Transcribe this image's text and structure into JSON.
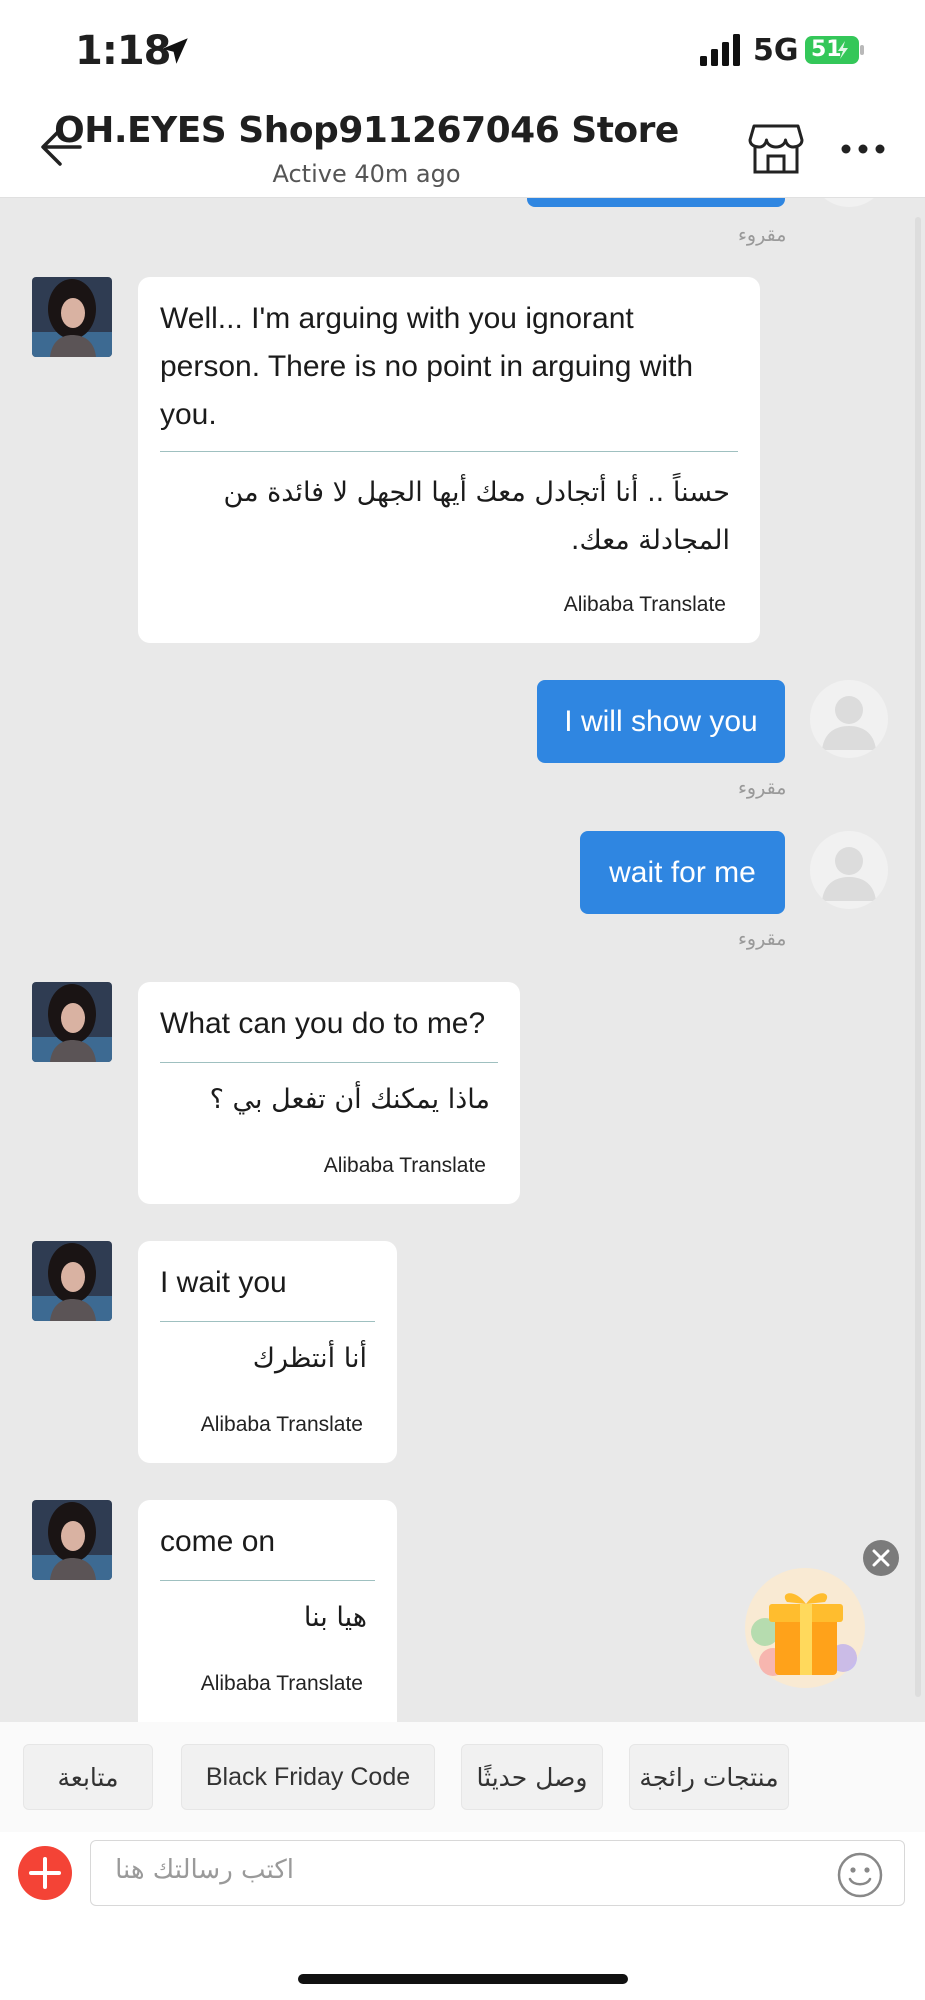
{
  "status_bar": {
    "time": "1:18",
    "network": "5G",
    "battery": "51"
  },
  "header": {
    "title": "OH.EYES Shop911267046 Store",
    "subtitle": "Active 40m ago"
  },
  "messages": {
    "read_label": "مقروء",
    "m1": {
      "text": "Well... I'm arguing with you ignorant person. There is no point in arguing with you.",
      "translation": "حسناً .. أنا أتجادل معك أيها الجهل لا فائدة من المجادلة معك.",
      "translator": "Alibaba Translate"
    },
    "out1": {
      "text": "I will show you"
    },
    "out2": {
      "text": "wait for me"
    },
    "m2": {
      "text": "What can you do to me?",
      "translation": "ماذا يمكنك أن تفعل بي ؟",
      "translator": "Alibaba Translate"
    },
    "m3": {
      "text": "I wait you",
      "translation": "أنا أنتظرك",
      "translator": "Alibaba Translate"
    },
    "m4": {
      "text": "come on",
      "translation": "هيا بنا",
      "translator": "Alibaba Translate"
    }
  },
  "quick_replies": [
    "متابعة",
    "Black Friday Code",
    "وصل حديثًا",
    "منتجات رائجة"
  ],
  "composer": {
    "placeholder": "اكتب رسالتك هنا"
  },
  "colors": {
    "outgoing": "#2f86e1",
    "add_button": "#f44336",
    "background": "#e9e9e9"
  }
}
